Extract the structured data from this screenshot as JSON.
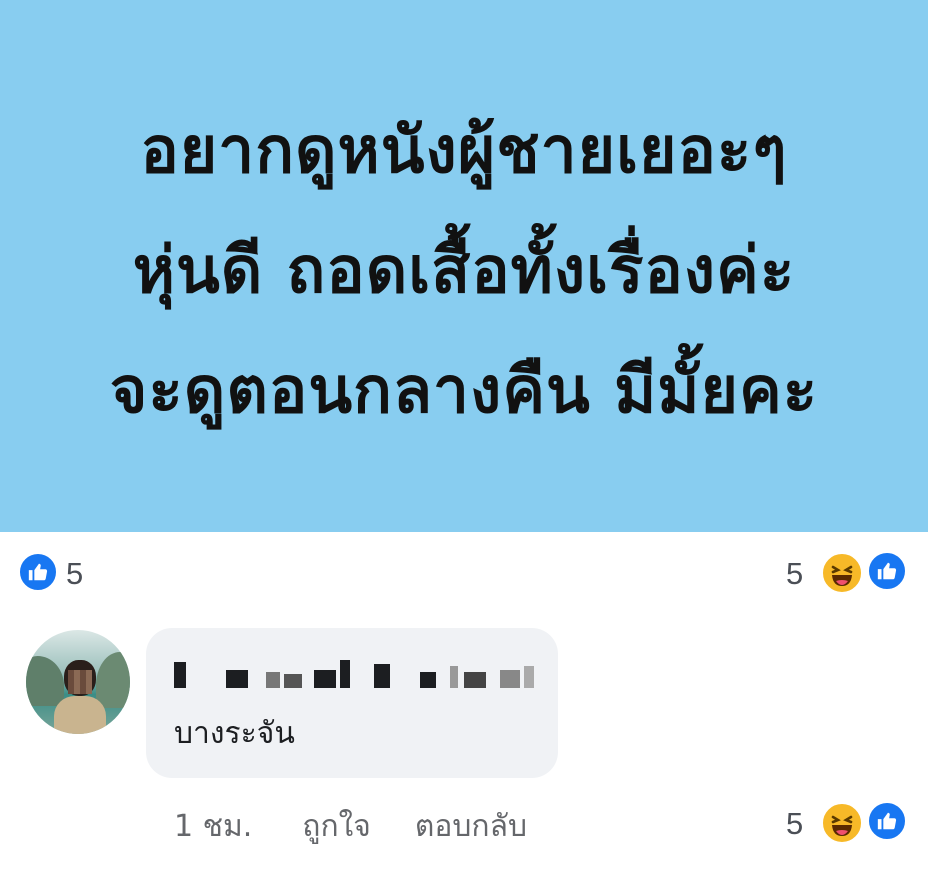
{
  "post": {
    "banner_lines": [
      "อยากดูหนังผู้ชายเยอะๆ",
      "หุ่นดี ถอดเสื้อทั้งเรื่องค่ะ",
      "จะดูตอนกลางคืน มีมั้ยคะ"
    ],
    "background_color": "#88cdf0"
  },
  "reactions": {
    "left_like_icon": "like-icon",
    "left_count": "5",
    "right_count": "5",
    "right_icons": [
      "haha-icon",
      "like-icon"
    ]
  },
  "comment": {
    "author_name_redacted": true,
    "text": "บางระจัน",
    "time": "1 ชม.",
    "like_label": "ถูกใจ",
    "reply_label": "ตอบกลับ",
    "reaction_count": "5",
    "reaction_icons": [
      "haha-icon",
      "like-icon"
    ]
  },
  "colors": {
    "facebook_blue": "#1877f2",
    "haha_yellow": "#f7b928",
    "bubble_gray": "#f0f2f5",
    "meta_text": "#65676b"
  }
}
